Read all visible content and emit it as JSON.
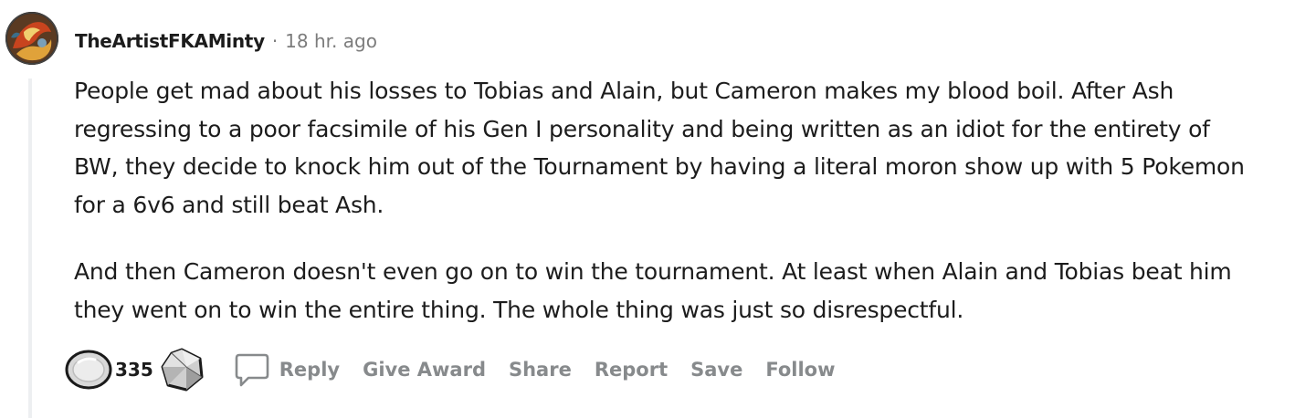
{
  "comment": {
    "author": "TheArtistFKAMinty",
    "separator": "·",
    "timestamp": "18 hr. ago",
    "paragraphs": [
      "People get mad about his losses to Tobias and Alain, but Cameron makes my blood boil. After Ash regressing to a poor facsimile of his Gen I personality and being written as an idiot for the entirety of BW, they decide to knock him out of the Tournament by having a literal moron show up with 5 Pokemon for a 6v6 and still beat Ash.",
      "And then Cameron doesn't even go on to win the tournament. At least when Alain and Tobias beat him they went on to win the entire thing. The whole thing was just so disrespectful."
    ],
    "score": "335"
  },
  "actions": {
    "reply": "Reply",
    "give_award": "Give Award",
    "share": "Share",
    "report": "Report",
    "save": "Save",
    "follow": "Follow"
  },
  "icons": {
    "avatar": "user-avatar",
    "upvote": "upvote-icon",
    "downvote": "downvote-icon",
    "reply": "comment-bubble-icon"
  }
}
